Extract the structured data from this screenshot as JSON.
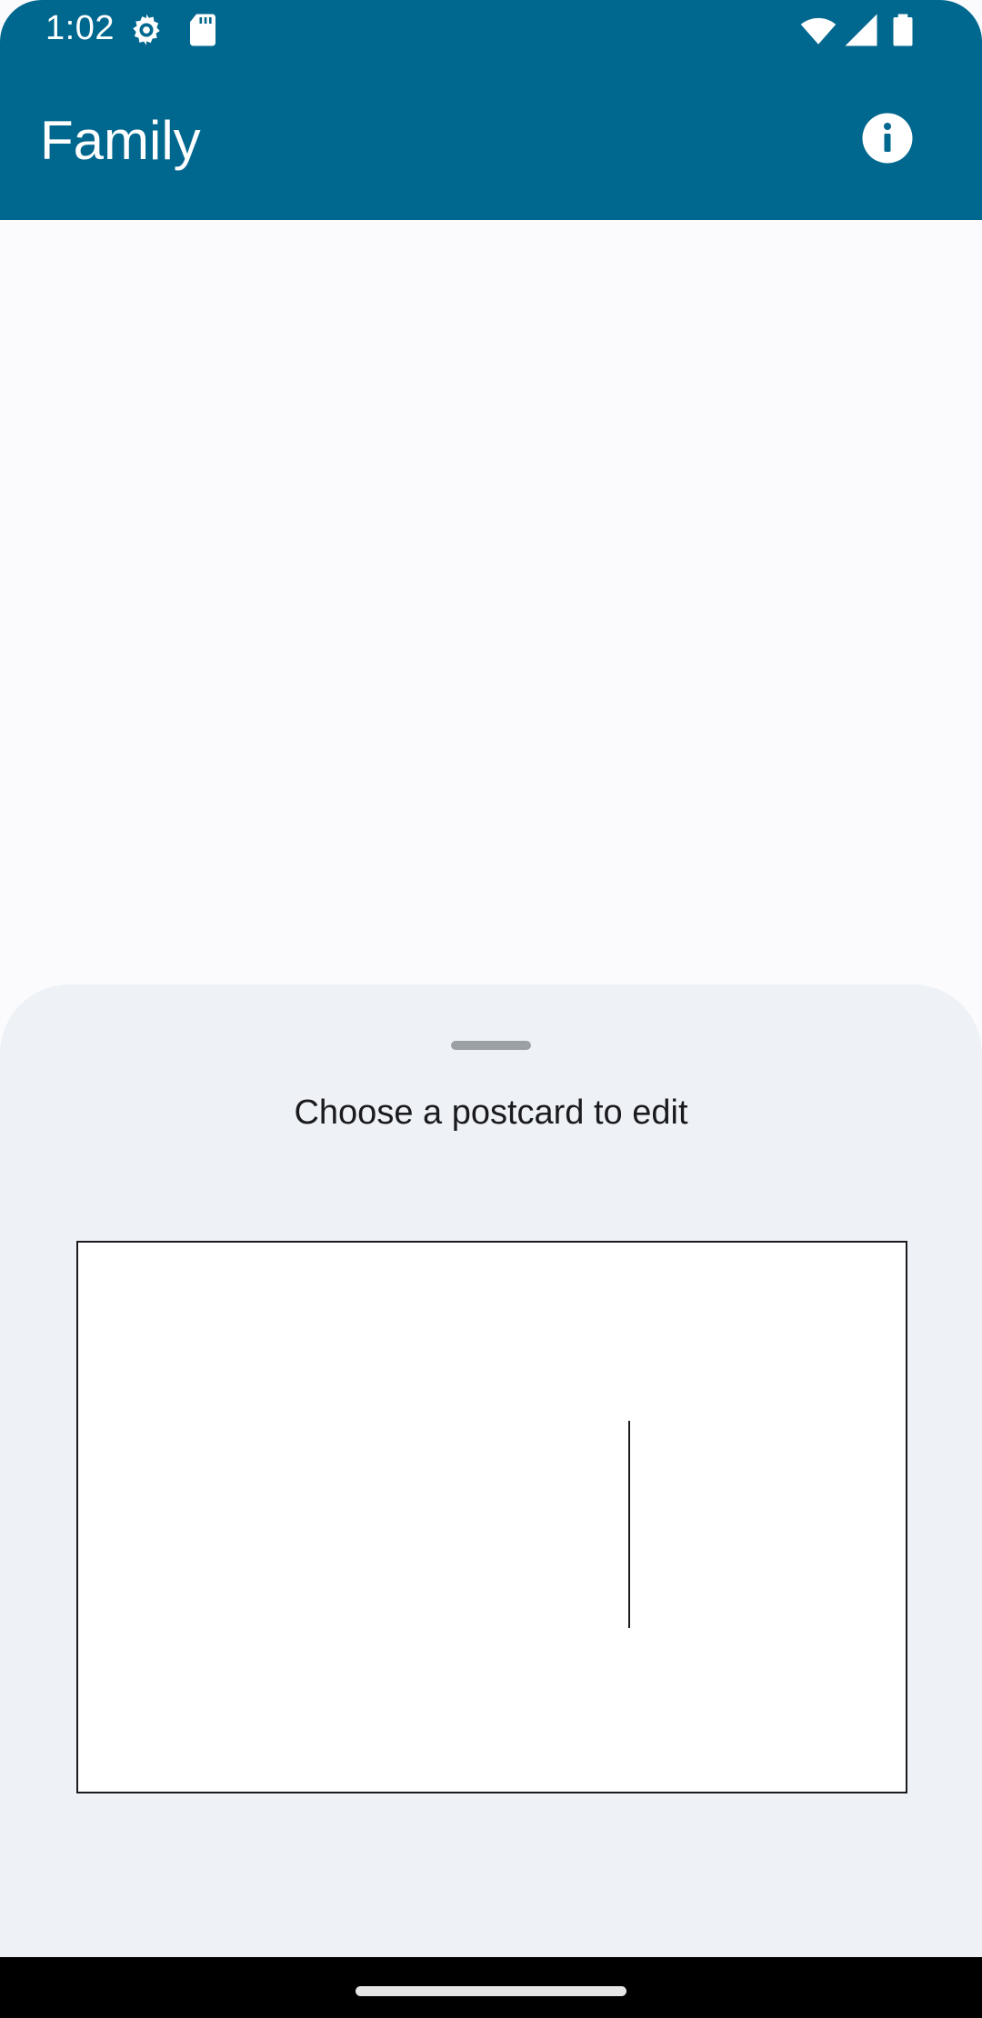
{
  "status_bar": {
    "time": "1:02",
    "icons": [
      "settings-gear-icon",
      "sd-card-icon",
      "wifi-icon",
      "cellular-signal-icon",
      "battery-icon"
    ]
  },
  "app_bar": {
    "title": "Family",
    "action_icon": "info-icon",
    "background_color": "#00678e"
  },
  "bottom_sheet": {
    "title": "Choose a postcard to edit",
    "background_color": "#eef2f6",
    "postcards": [
      {
        "icon": "postcard-template"
      }
    ]
  },
  "navigation_bar": {
    "handle": "home-gesture-handle"
  }
}
